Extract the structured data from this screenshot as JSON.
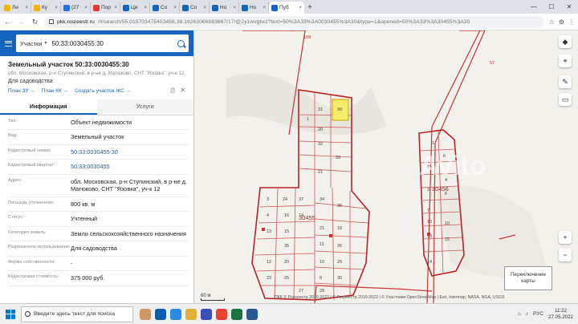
{
  "browser": {
    "tabs": [
      {
        "label": "Ли",
        "color": "#f5b400"
      },
      {
        "label": "Ку",
        "color": "#f5b400"
      },
      {
        "label": "(27",
        "color": "#1a73e8"
      },
      {
        "label": "Пор",
        "color": "#e53935"
      },
      {
        "label": "Ци",
        "color": "#1565c0"
      },
      {
        "label": "Со",
        "color": "#1565c0"
      },
      {
        "label": "Со",
        "color": "#1565c0"
      },
      {
        "label": "Но",
        "color": "#1565c0"
      },
      {
        "label": "Но",
        "color": "#1565c0"
      },
      {
        "label": "Пуб",
        "color": "#1565c0",
        "active": true
      }
    ],
    "url_host": "pkk.rosreestr.ru",
    "url_rest": "/#/search/55.015703475453456,38.16263066883867/17/@2y1wvgtwz?text=50%3A33%3A0030455%3A30&type=1&opened=50%3A33%3A30455%3A30"
  },
  "search": {
    "type_label": "Участки",
    "query": "50:33:0030455:30"
  },
  "object": {
    "title": "Земельный участок 50:33:0030455:30",
    "address_line": "обл. Московская, р-н Ступинский, в р-не д. Матюково, СНТ \"Язовка\", уч-к 12",
    "purpose": "Для садоводства",
    "links": [
      "План ЗУ →",
      "План КК →",
      "Создать участок ЖС →"
    ]
  },
  "info_tabs": {
    "info": "Информация",
    "services": "Услуги"
  },
  "attributes": [
    {
      "label": "Тип:",
      "value": "Объект недвижимости"
    },
    {
      "label": "Вид:",
      "value": "Земельный участок"
    },
    {
      "label": "Кадастровый номер:",
      "value": "50:33:0030455:30",
      "link": true
    },
    {
      "label": "Кадастровый квартал:",
      "value": "50:33:0030455",
      "link": true
    },
    {
      "label": "Адрес:",
      "value": "обл. Московская, р-н Ступинский, в р-не д. Матюково, СНТ \"Язовка\", уч-к 12"
    },
    {
      "label": "Площадь уточненная:",
      "value": "800 кв. м"
    },
    {
      "label": "Статус:",
      "value": "Учтенный"
    },
    {
      "label": "Категория земель:",
      "value": "Земли сельскохозяйственного назначения"
    },
    {
      "label": "Разрешенное использование:",
      "value": "Для садоводства"
    },
    {
      "label": "Форма собственности:",
      "value": "-"
    },
    {
      "label": "Кадастровая стоимость:",
      "value": "375 000 руб."
    }
  ],
  "map": {
    "labels": {
      "quarter_main": "30455",
      "quarter_right": "30456",
      "north": "169",
      "east": "57"
    },
    "switch_label": "Переключение карты",
    "scale": "60 м",
    "attribution": "ПКК © Росреестр 2010-2022 | © Росреестр 2019-2022 | © Участники OpenStreetMap | Esri, Intermap, NASA, NGA, USGS",
    "watermark": "Avito"
  },
  "taskbar": {
    "search_placeholder": "Введите здесь текст для поиска",
    "lang": "РУС",
    "time": "11:22",
    "date": "27.05.2022"
  }
}
